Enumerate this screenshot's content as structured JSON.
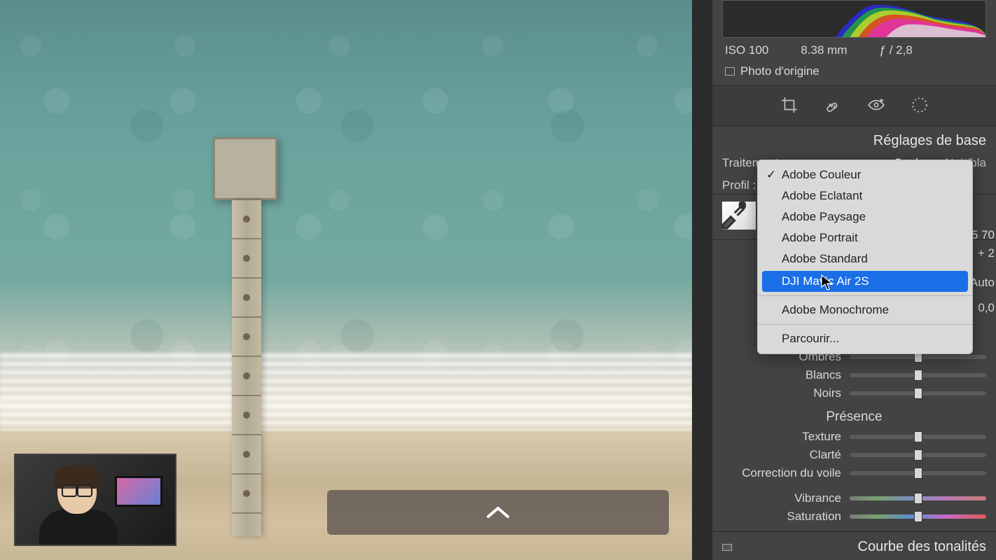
{
  "meta": {
    "iso": "ISO 100",
    "focal": "8.38 mm",
    "aperture": "ƒ / 2,8"
  },
  "origin_label": "Photo d'origine",
  "section_basic": "Réglages de base",
  "treatment": {
    "label": "Traitement :",
    "color": "Couleur",
    "bw": "Noir/bla"
  },
  "profile_label": "Profil :",
  "dropdown": {
    "items": [
      {
        "label": "Adobe Couleur",
        "checked": true
      },
      {
        "label": "Adobe Eclatant"
      },
      {
        "label": "Adobe Paysage"
      },
      {
        "label": "Adobe Portrait"
      },
      {
        "label": "Adobe Standard"
      },
      {
        "label": "DJI Mavic Air 2S",
        "highlight": true
      }
    ],
    "mono": "Adobe Monochrome",
    "browse": "Parcourir..."
  },
  "right_values": {
    "v1": "5 70",
    "v2": "+ 2",
    "auto": "Auto",
    "zero": "0,0"
  },
  "sliders": {
    "ombres": "Ombres",
    "blancs": "Blancs",
    "noirs": "Noirs",
    "texture": "Texture",
    "clarte": "Clarté",
    "voile": "Correction du voile",
    "vibrance": "Vibrance",
    "saturation": "Saturation"
  },
  "presence": "Présence",
  "tone_curve": "Courbe des tonalités"
}
